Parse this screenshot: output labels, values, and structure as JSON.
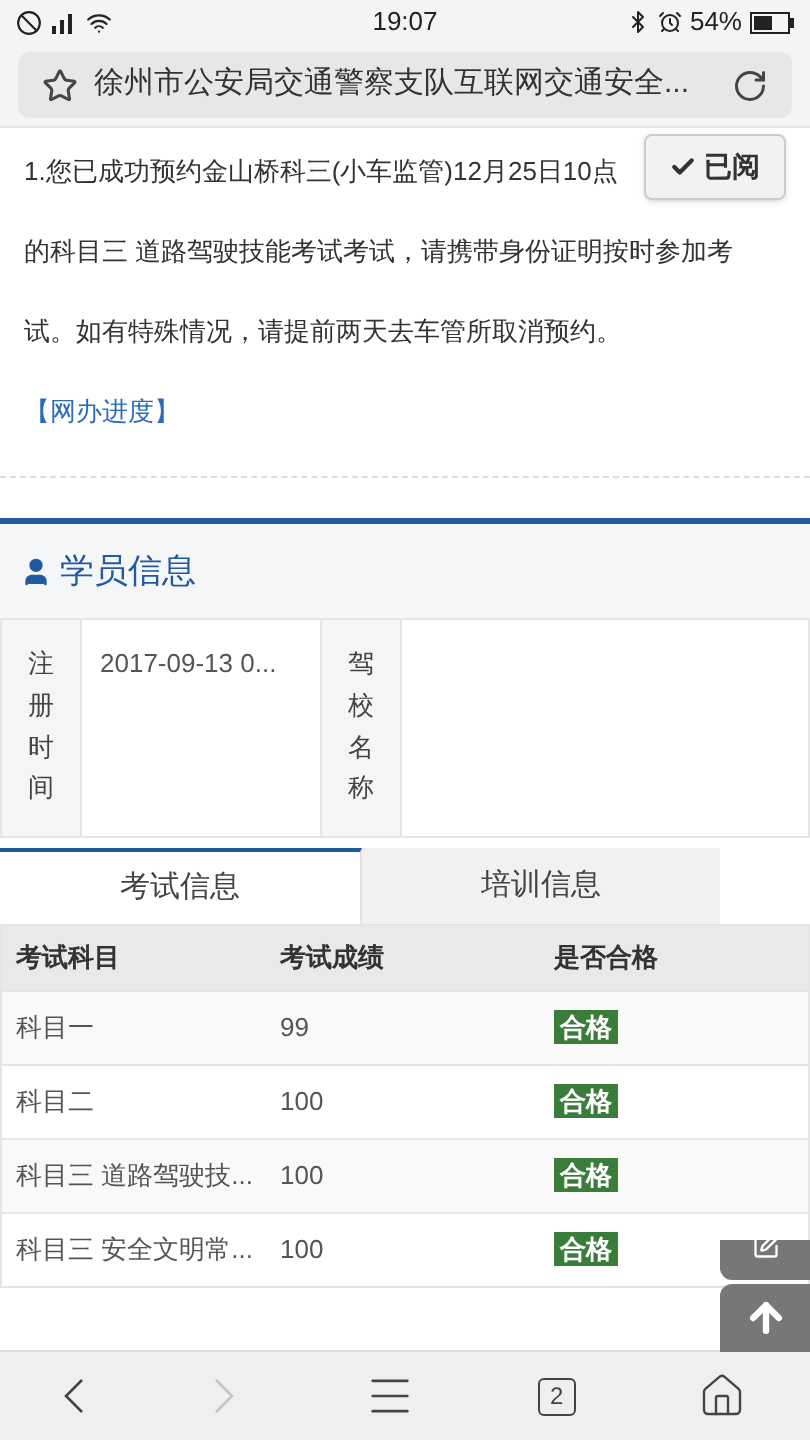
{
  "status_bar": {
    "time": "19:07",
    "battery": "54%"
  },
  "address_bar": {
    "title": "徐州市公安局交通警察支队互联网交通安全..."
  },
  "notice": {
    "first_line": "1.您已成功预约金山桥科三(小车监管)12月25日10点",
    "text": "的科目三 道路驾驶技能考试考试，请携带身份证明按时参加考试。如有特殊情况，请提前两天去车管所取消预约。",
    "link": "【网办进度】",
    "read_button": {
      "label": "已阅",
      "checked": true
    }
  },
  "student_section": {
    "title": "学员信息",
    "fields": [
      {
        "label": "注册时间",
        "value": "2017-09-13 0..."
      },
      {
        "label": "驾校名称"
      }
    ]
  },
  "tabs": [
    {
      "label": "考试信息",
      "selected": true
    },
    {
      "label": "培训信息",
      "selected": false
    }
  ],
  "table": {
    "columns": [
      "考试科目",
      "考试成绩",
      "是否合格"
    ],
    "rows": [
      {
        "subject": "科目一",
        "score": "99",
        "result": "合格",
        "passed": true
      },
      {
        "subject": "科目二",
        "score": "100",
        "result": "合格",
        "passed": true
      },
      {
        "subject": "科目三 道路驾驶技...",
        "score": "100",
        "result": "合格",
        "passed": true
      },
      {
        "subject": "科目三 安全文明常...",
        "score": "100",
        "result": "合格",
        "passed": true
      }
    ]
  },
  "bottom_nav": {
    "tab_count": "2",
    "forward_disabled": true
  }
}
